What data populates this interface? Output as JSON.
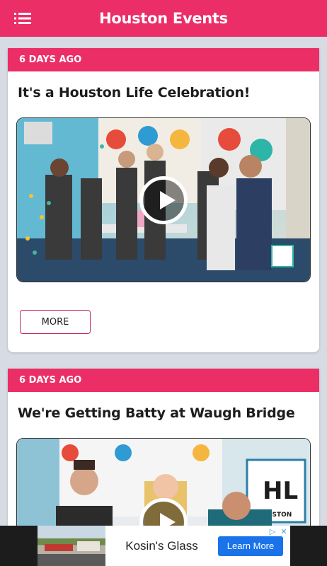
{
  "app_bar": {
    "title": "Houston Events",
    "menu_icon": "menu-list-icon",
    "color": "#ec2e67"
  },
  "events": [
    {
      "age": "6 DAYS AGO",
      "title": "It's a Houston Life Celebration!",
      "more_label": "MORE"
    },
    {
      "age": "6 DAYS AGO",
      "title": "We're Getting Batty at Waugh Bridge"
    }
  ],
  "ad": {
    "text": "Kosin's Glass",
    "cta": "Learn More",
    "cta_color": "#1a73e8"
  }
}
